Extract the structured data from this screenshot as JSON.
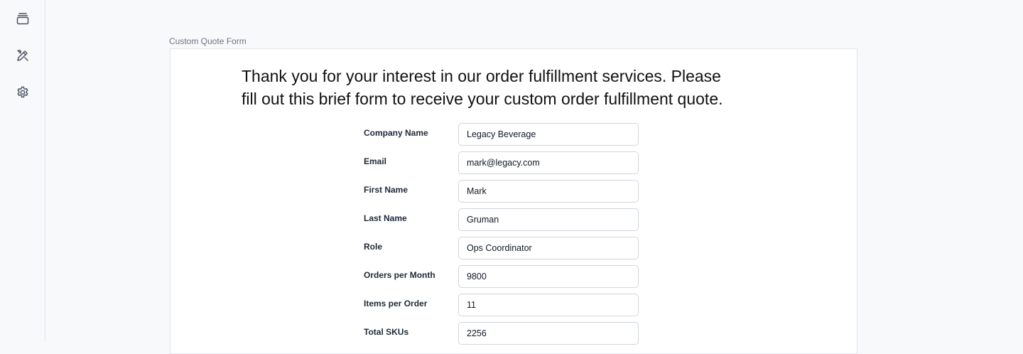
{
  "sidebar": {
    "items": [
      {
        "icon": "layers-icon",
        "name": "sidebar-item-collections"
      },
      {
        "icon": "edit-tools-icon",
        "name": "sidebar-item-editor"
      },
      {
        "icon": "gear-icon",
        "name": "sidebar-item-settings"
      }
    ]
  },
  "form": {
    "caption": "Custom Quote Form",
    "intro_line1": "Thank you for your interest in our order fulfillment services. Please",
    "intro_line2": "fill out this brief form to receive your custom order fulfillment quote.",
    "fields": [
      {
        "label": "Company Name",
        "value": "Legacy Beverage"
      },
      {
        "label": "Email",
        "value": "mark@legacy.com"
      },
      {
        "label": "First Name",
        "value": "Mark"
      },
      {
        "label": "Last Name",
        "value": "Gruman"
      },
      {
        "label": "Role",
        "value": "Ops Coordinator"
      },
      {
        "label": "Orders per Month",
        "value": "9800"
      },
      {
        "label": "Items per Order",
        "value": "11"
      },
      {
        "label": "Total SKUs",
        "value": "2256"
      }
    ]
  },
  "colors": {
    "background": "#f8f9fb",
    "card": "#ffffff",
    "border": "#e3e5ea",
    "icon": "#4b5563"
  }
}
